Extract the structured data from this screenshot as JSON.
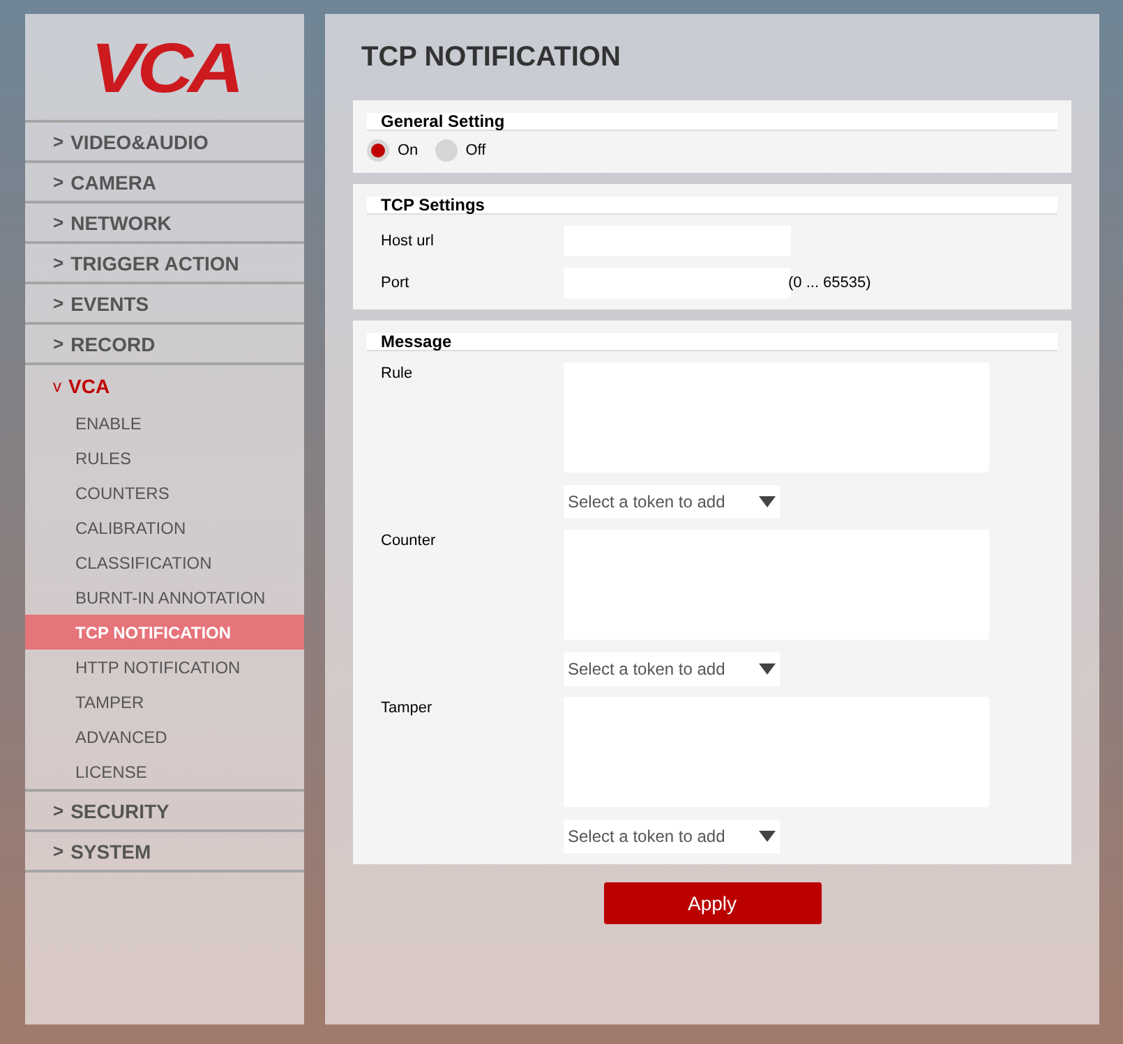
{
  "logo": {
    "text": "VCA"
  },
  "sidebar": {
    "items": [
      {
        "marker": ">",
        "label": "VIDEO&AUDIO",
        "expanded": false
      },
      {
        "marker": ">",
        "label": "CAMERA",
        "expanded": false
      },
      {
        "marker": ">",
        "label": "NETWORK",
        "expanded": false
      },
      {
        "marker": ">",
        "label": "TRIGGER ACTION",
        "expanded": false
      },
      {
        "marker": ">",
        "label": "EVENTS",
        "expanded": false
      },
      {
        "marker": ">",
        "label": "RECORD",
        "expanded": false
      },
      {
        "marker": "v",
        "label": "VCA",
        "expanded": true,
        "children": [
          {
            "label": "ENABLE",
            "selected": false
          },
          {
            "label": "RULES",
            "selected": false
          },
          {
            "label": "COUNTERS",
            "selected": false
          },
          {
            "label": "CALIBRATION",
            "selected": false
          },
          {
            "label": "CLASSIFICATION",
            "selected": false
          },
          {
            "label": "BURNT-IN ANNOTATION",
            "selected": false
          },
          {
            "label": "TCP NOTIFICATION",
            "selected": true
          },
          {
            "label": "HTTP NOTIFICATION",
            "selected": false
          },
          {
            "label": "TAMPER",
            "selected": false
          },
          {
            "label": "ADVANCED",
            "selected": false
          },
          {
            "label": "LICENSE",
            "selected": false
          }
        ]
      },
      {
        "marker": ">",
        "label": "SECURITY",
        "expanded": false
      },
      {
        "marker": ">",
        "label": "SYSTEM",
        "expanded": false
      }
    ]
  },
  "page": {
    "title": "TCP NOTIFICATION"
  },
  "general_setting": {
    "title": "General Setting",
    "options": [
      {
        "label": "On",
        "selected": true
      },
      {
        "label": "Off",
        "selected": false
      }
    ]
  },
  "tcp_settings": {
    "title": "TCP Settings",
    "fields": [
      {
        "label": "Host url"
      },
      {
        "label": "Port",
        "hint": "(0 ... 65535)"
      }
    ]
  },
  "message": {
    "title": "Message",
    "fields": [
      {
        "label": "Rule",
        "select": "Select a token to add"
      },
      {
        "label": "Counter",
        "select": "Select a token to add"
      },
      {
        "label": "Tamper",
        "select": "Select a token to add"
      }
    ]
  },
  "apply_button": "Apply"
}
